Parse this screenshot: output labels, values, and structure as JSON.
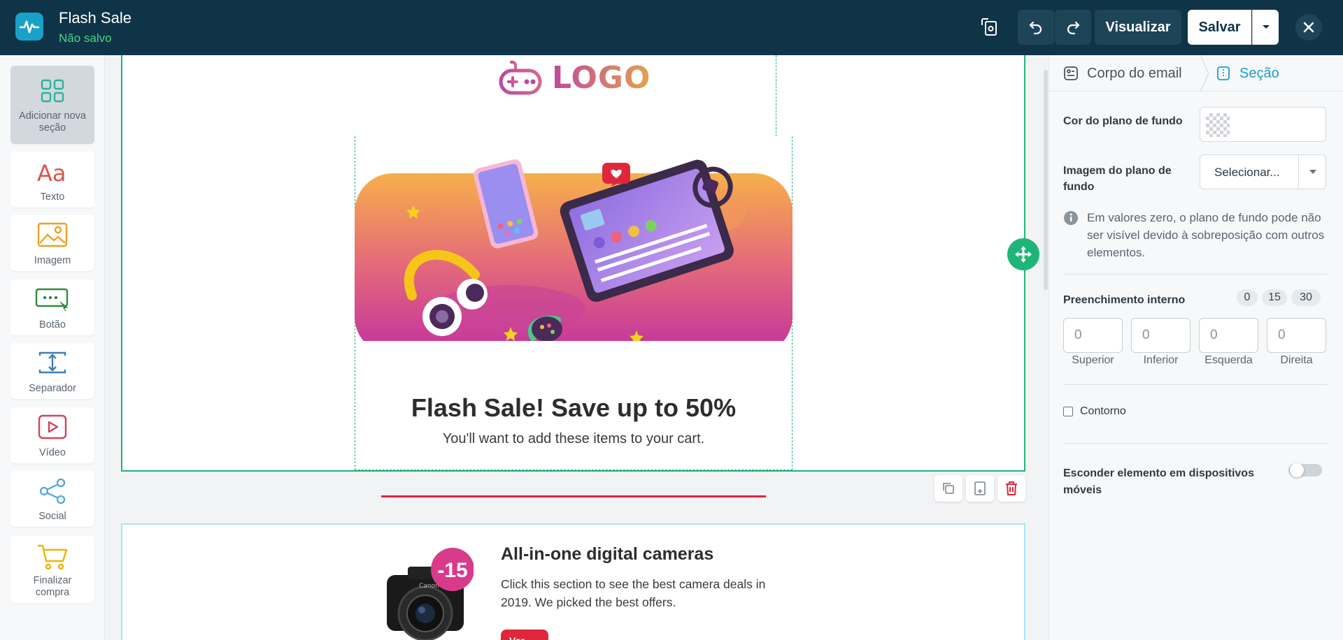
{
  "header": {
    "title": "Flash Sale",
    "status": "Não salvo",
    "preview_label": "Visualizar",
    "save_label": "Salvar"
  },
  "toolbox": {
    "items": [
      {
        "label": "Adicionar nova seção",
        "icon": "grid-icon",
        "active": true
      },
      {
        "label": "Texto",
        "icon": "text-icon"
      },
      {
        "label": "Imagem",
        "icon": "image-icon"
      },
      {
        "label": "Botão",
        "icon": "button-icon"
      },
      {
        "label": "Separador",
        "icon": "separator-icon"
      },
      {
        "label": "Vídeo",
        "icon": "video-icon"
      },
      {
        "label": "Social",
        "icon": "share-icon"
      },
      {
        "label": "Finalizar compra",
        "icon": "cart-icon"
      }
    ]
  },
  "canvas": {
    "logo_text": "LOGO",
    "headline": "Flash Sale! Save up to 50%",
    "subline": "You'll want to add these items to your cart.",
    "product": {
      "badge": "-15",
      "title": "All-in-one digital cameras",
      "description": "Click this section to see the best camera deals in 2019. We picked the best offers.",
      "button_label": "Ver"
    }
  },
  "panel": {
    "tabs": [
      {
        "label": "Corpo do email",
        "icon": "email-body-icon"
      },
      {
        "label": "Seção",
        "icon": "section-icon",
        "active": true
      }
    ],
    "background_color_label": "Cor do plano de fundo",
    "background_image_label": "Imagem do plano de fundo",
    "background_image_select": "Selecionar...",
    "info_text": "Em valores zero, o plano de fundo pode não ser visível devido à sobreposição com outros elementos.",
    "padding_label": "Preenchimento interno",
    "padding_presets": [
      "0",
      "15",
      "30"
    ],
    "padding_fields": [
      {
        "label": "Superior",
        "value": "0"
      },
      {
        "label": "Inferior",
        "value": "0"
      },
      {
        "label": "Esquerda",
        "value": "0"
      },
      {
        "label": "Direita",
        "value": "0"
      }
    ],
    "border_label": "Contorno",
    "hide_mobile_label": "Esconder elemento em dispositivos móveis"
  },
  "colors": {
    "topbar": "#0f3447",
    "accent_green": "#1fb57a",
    "accent_blue": "#1aa1c9",
    "danger": "#e0263c"
  }
}
